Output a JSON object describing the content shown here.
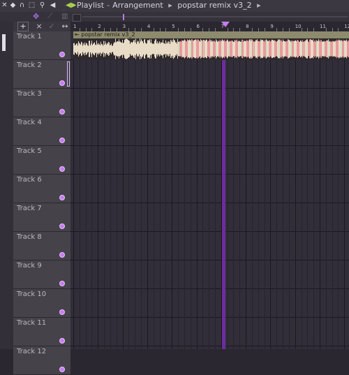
{
  "toolbar": {
    "icons": [
      "close-icon",
      "arrows-icon",
      "magnet-icon",
      "select-icon",
      "zoom-icon",
      "speaker-icon",
      "play-icon"
    ]
  },
  "breadcrumb": {
    "part1": "Playlist",
    "part2": "Arrangement",
    "part3": "popstar remix v3_2",
    "arrow": "▸"
  },
  "track_header": {
    "add_label": "+",
    "close_label": "×",
    "expand_label": "↔"
  },
  "ruler": {
    "bars": [
      "1",
      "2",
      "3",
      "4",
      "5",
      "6",
      "7",
      "8",
      "9",
      "10",
      "11",
      "12"
    ]
  },
  "tracks": [
    {
      "label": "Track 1"
    },
    {
      "label": "Track 2"
    },
    {
      "label": "Track 3"
    },
    {
      "label": "Track 4"
    },
    {
      "label": "Track 5"
    },
    {
      "label": "Track 6"
    },
    {
      "label": "Track 7"
    },
    {
      "label": "Track 8"
    },
    {
      "label": "Track 9"
    },
    {
      "label": "Track 10"
    },
    {
      "label": "Track 11"
    },
    {
      "label": "Track 12"
    }
  ],
  "clip": {
    "title": "popstar remix v3_2",
    "waveform_color_light": "#e9dcc6",
    "waveform_color_pink": "#e89a9f",
    "waveform_color_green": "#b7e3b3"
  },
  "colors": {
    "playhead": "#6b2da0",
    "marker": "#c47cf0",
    "accent": "#c77df0"
  }
}
